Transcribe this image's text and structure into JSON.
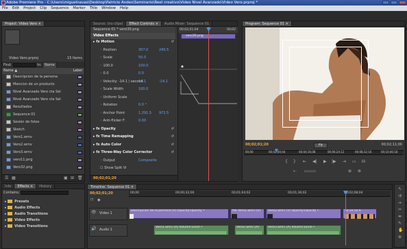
{
  "window": {
    "title": "Adobe Premiere Pro - C:\\Users\\miguelnavas\\Desktop\\Patricio Andes\\Seminario\\Reel creativo\\Video Nivel Avanzado\\Video Vero.prproj *"
  },
  "menu": [
    "File",
    "Edit",
    "Project",
    "Clip",
    "Sequence",
    "Marker",
    "Title",
    "Window",
    "Help"
  ],
  "project": {
    "tab": "Project: Video Vero ×",
    "file_name": "Video Vero.prproj",
    "item_count": "15 Items",
    "find_label": "In:",
    "find_value": "Name",
    "find_button": "Find:",
    "col_name": "Name ▲",
    "col_label": "Label",
    "items": [
      {
        "name": "Descripcion de la persona",
        "kind": "title",
        "color": "violet"
      },
      {
        "name": "Mencion de un producto",
        "kind": "title",
        "color": "violet"
      },
      {
        "name": "Nivel Avanzado Vero cta Sel",
        "kind": "file",
        "color": "violet"
      },
      {
        "name": "Nivel Avanzado Vero cta Sel",
        "kind": "file",
        "color": "violet"
      },
      {
        "name": "Resultados",
        "kind": "title",
        "color": "violet"
      },
      {
        "name": "Sequence 01",
        "kind": "seq",
        "color": "green"
      },
      {
        "name": "Sesión de fotos",
        "kind": "title",
        "color": "violet"
      },
      {
        "name": "Sketch",
        "kind": "title",
        "color": "violet"
      },
      {
        "name": "Vero1.wmv",
        "kind": "file",
        "color": "blue"
      },
      {
        "name": "Vero2.wmv",
        "kind": "file",
        "color": "blue"
      },
      {
        "name": "Vero3.wmv",
        "kind": "file",
        "color": "blue"
      },
      {
        "name": "vero11.png",
        "kind": "file",
        "color": "violet"
      },
      {
        "name": "Vero32.png",
        "kind": "file",
        "color": "violet"
      }
    ]
  },
  "effects_panel": {
    "tabs": [
      "Info",
      "Effects ×",
      "History"
    ],
    "contains_label": "Contains:",
    "folders": [
      "Presets",
      "Audio Effects",
      "Audio Transitions",
      "Video Effects",
      "Video Transitions"
    ]
  },
  "source": {
    "tabs": [
      "Source: (no clips)",
      "Effect Controls ×",
      "Audio Mixer: Sequence 01"
    ],
    "clip_path": "Sequence 01 * vero30.png",
    "mini_tc": "00;02;01;04",
    "mini_tc2": "00;02",
    "clip_name": "vero30.png",
    "section": "Video Effects",
    "rows": [
      {
        "label": "Motion",
        "type": "group"
      },
      {
        "label": "Position",
        "value1": "307.0",
        "value2": "240.5"
      },
      {
        "label": "Scale",
        "value1": "50.0"
      },
      {
        "label": "100.0",
        "value1": "100.0",
        "type": "scale"
      },
      {
        "label": "0.0",
        "value1": "0.0",
        "type": "scale"
      },
      {
        "label": "Velocity: -14.1 / second",
        "value1": "14.1",
        "value2": "-14.1"
      },
      {
        "label": "Scale Width",
        "value1": "100.0"
      },
      {
        "label": "Uniform Scale"
      },
      {
        "label": "Rotation",
        "value1": "0.0 °"
      },
      {
        "label": "Anchor Point",
        "value1": "1.291.5",
        "value2": "972.5"
      },
      {
        "label": "Anti-flicker F.",
        "value1": "0.00"
      },
      {
        "label": "Opacity",
        "type": "group"
      },
      {
        "label": "Time Remapping",
        "type": "group"
      },
      {
        "label": "Auto Color",
        "type": "group"
      },
      {
        "label": "Three-Way Color Corrector",
        "type": "group"
      },
      {
        "label": "Output",
        "value1": "Composite"
      },
      {
        "label": "Show Split Vi",
        "type": "check"
      }
    ],
    "bottom_tc": "00;02;01;20"
  },
  "program": {
    "tab": "Program: Sequence 01 ×",
    "timecode": "00;02;01;20",
    "fit": "Fit",
    "duration": "00;02;11;00",
    "ruler": [
      "00;00",
      "00;02;00;04",
      "00;04;16;08",
      "00;06;24;12",
      "00;08;32;16",
      "00;10;40;18"
    ]
  },
  "timeline": {
    "tab": "Timeline: Sequence 01 ×",
    "timecode": "00;02;01;20",
    "ruler": [
      "00;00",
      "00;00;32;00",
      "00;01;04;02",
      "00;01;36;02",
      "00;02;08;04"
    ],
    "tracks": [
      {
        "name": "Video 1",
        "kind": "video"
      },
      {
        "name": "Audio 1",
        "kind": "audio"
      }
    ],
    "video_clips": [
      {
        "label": "Descripcion de la persona [V] Opacity:Opacity •"
      },
      {
        "label": "Me  Vero1.wmv [V]"
      },
      {
        "label": "Vero2.wmv [V] Opacity:Opacity •"
      },
      {
        "label": "Se  ve  ve  R"
      }
    ],
    "audio_clips": [
      {
        "label": "Vero1.wmv [A] Volume:Level •"
      },
      {
        "label": "Vero2.wmv [A]"
      },
      {
        "label": "Vero3.wmv [A] Volume:Level •"
      }
    ]
  },
  "colors": {
    "accent": "#f0a640",
    "playhead": "#e85050",
    "video_clip": "#8a78c0",
    "audio_clip": "#5a8b5a"
  }
}
